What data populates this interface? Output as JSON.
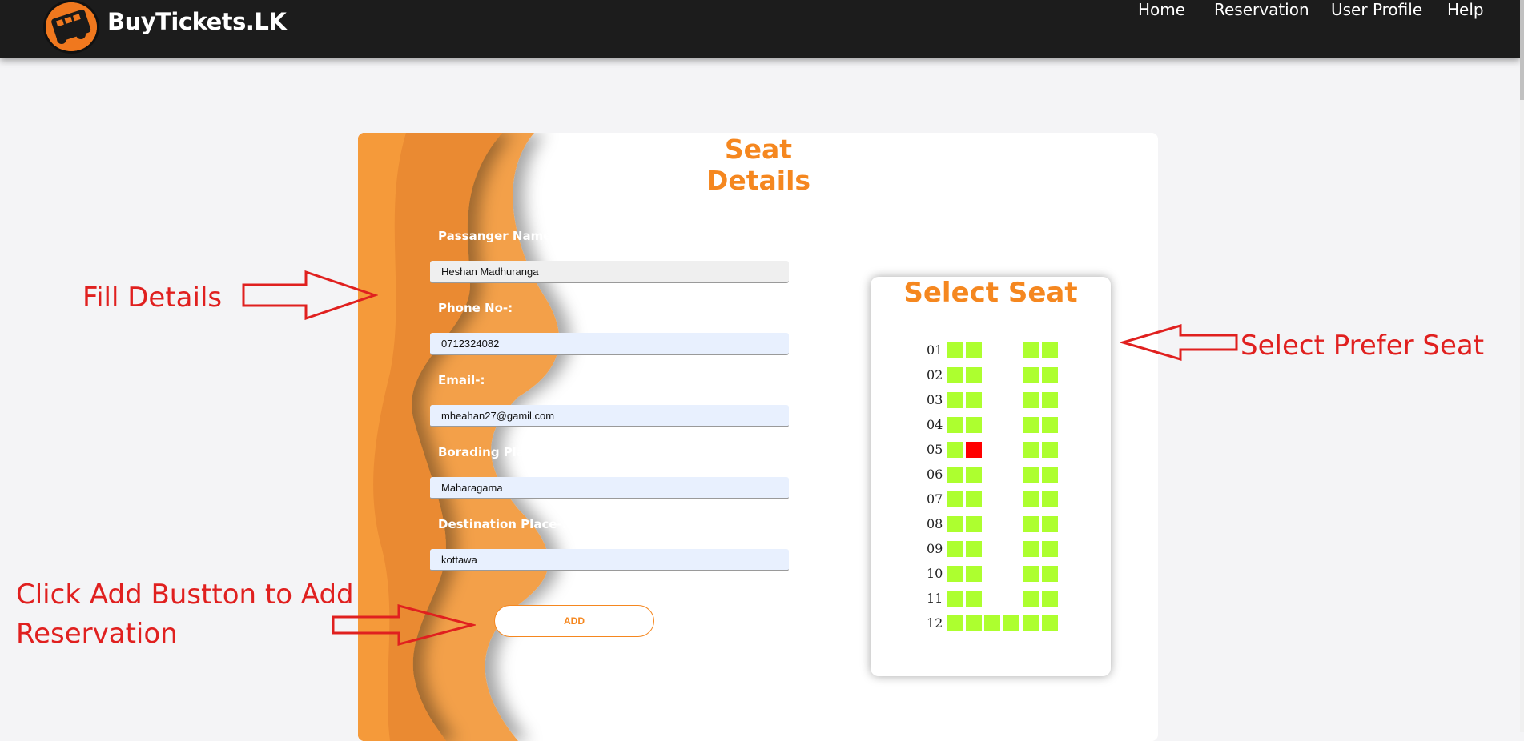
{
  "brand": {
    "name": "BuyTickets.LK"
  },
  "nav": {
    "items": [
      {
        "label": "Home"
      },
      {
        "label": "Reservation"
      },
      {
        "label": "User Profile"
      },
      {
        "label": "Help"
      }
    ]
  },
  "form": {
    "title": "Seat Details",
    "fields": [
      {
        "label": "Passanger Name-:",
        "value": "Heshan Madhuranga"
      },
      {
        "label": "Phone No-:",
        "value": "0712324082"
      },
      {
        "label": "Email-:",
        "value": "mheahan27@gamil.com"
      },
      {
        "label": "Borading Place-:",
        "value": "Maharagama"
      },
      {
        "label": "Destination Place-:",
        "value": "kottawa"
      }
    ],
    "add_label": "ADD"
  },
  "seat_panel": {
    "title": "Select Seat",
    "rows": [
      "01",
      "02",
      "03",
      "04",
      "05",
      "06",
      "07",
      "08",
      "09",
      "10",
      "11",
      "12"
    ],
    "booked": [
      {
        "row": "05",
        "seat": 2
      }
    ],
    "colors": {
      "available": "#adff2f",
      "booked": "#ff0000"
    }
  },
  "annotations": {
    "fill_details": "Fill Details",
    "select_seat": "Select Prefer Seat",
    "click_add_line1": "Click Add Bustton to Add",
    "click_add_line2": "Reservation"
  },
  "colors": {
    "accent": "#f5871f",
    "navbar": "#1c1c1c",
    "annotation": "#e0201f"
  }
}
